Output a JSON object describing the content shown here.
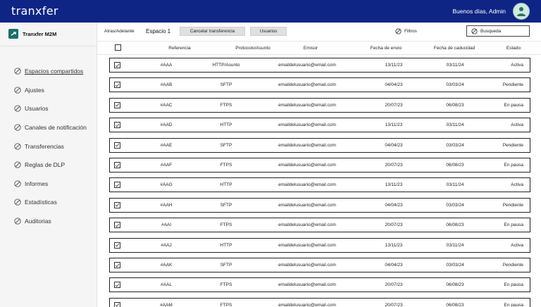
{
  "app": {
    "logo": "tranxfer",
    "greeting": "Buenos días, Admin"
  },
  "brand": {
    "name": "Tranxfer M2M"
  },
  "toolbar": {
    "back_forward": "Atras/Adelante",
    "space_title": "Espacio 1",
    "cancel_label": "Cancelar transferencia",
    "users_label": "Usuarios",
    "filters_label": "Filtros",
    "search_placeholder": "Busqueda"
  },
  "sidebar": {
    "items": [
      {
        "label": "Espacios compartidos",
        "active": true
      },
      {
        "label": "Ajustes"
      },
      {
        "label": "Usuarios"
      },
      {
        "label": "Canales de notificación"
      },
      {
        "label": "Transferencias"
      },
      {
        "label": "Reglas de DLP"
      },
      {
        "label": "Informes"
      },
      {
        "label": "Estadísticas"
      },
      {
        "label": "Auditorias"
      }
    ]
  },
  "table": {
    "columns": {
      "referencia": "Referencia",
      "protocolo": "Protocolo/Asunto",
      "emisor": "Emisor",
      "envio": "Fecha de envio",
      "caducidad": "Fecha de caducidad",
      "estado": "Estado"
    },
    "rows": [
      {
        "ref": "#AAA",
        "proto": "HTTP/Asunto",
        "emisor": "emaildelusuario@email.com",
        "envio": "13/11/23",
        "cad": "03/11/24",
        "estado": "Activa"
      },
      {
        "ref": "#AAB",
        "proto": "SFTP",
        "emisor": "emaildelusuario@email.com",
        "envio": "04/04/23",
        "cad": "03/03/24",
        "estado": "Pendiente"
      },
      {
        "ref": "#AAC",
        "proto": "FTPS",
        "emisor": "emaildelusuario@email.com",
        "envio": "20/07/23",
        "cad": "06/08/23",
        "estado": "En pausa"
      },
      {
        "ref": "#AAD",
        "proto": "HTTP",
        "emisor": "emaildelusuario@email.com",
        "envio": "13/11/23",
        "cad": "03/11/24",
        "estado": "Activa"
      },
      {
        "ref": "#AAE",
        "proto": "SFTP",
        "emisor": "emaildelusuario@email.com",
        "envio": "04/04/23",
        "cad": "03/03/24",
        "estado": "Pendiente"
      },
      {
        "ref": "#AAF",
        "proto": "FTPS",
        "emisor": "emaildelusuario@email.com",
        "envio": "20/07/23",
        "cad": "06/08/23",
        "estado": "En pausa"
      },
      {
        "ref": "#AAG",
        "proto": "HTTP",
        "emisor": "emaildelusuario@email.com",
        "envio": "13/11/23",
        "cad": "03/11/24",
        "estado": "Activa"
      },
      {
        "ref": "#AAH",
        "proto": "SFTP",
        "emisor": "emaildelusuario@email.com",
        "envio": "04/04/23",
        "cad": "03/03/24",
        "estado": "Pendiente"
      },
      {
        "ref": "#AAI",
        "proto": "FTPS",
        "emisor": "emaildelusuario@email.com",
        "envio": "20/07/23",
        "cad": "06/08/23",
        "estado": "En pausa"
      },
      {
        "ref": "#AAJ",
        "proto": "HTTP",
        "emisor": "emaildelusuario@email.com",
        "envio": "13/11/23",
        "cad": "03/11/24",
        "estado": "Activa"
      },
      {
        "ref": "#AAK",
        "proto": "SFTP",
        "emisor": "emaildelusuario@email.com",
        "envio": "04/04/23",
        "cad": "03/03/24",
        "estado": "Pendiente"
      },
      {
        "ref": "#AAL",
        "proto": "FTPS",
        "emisor": "emaildelusuario@email.com",
        "envio": "20/07/23",
        "cad": "06/08/23",
        "estado": "En pausa"
      },
      {
        "ref": "#AAM",
        "proto": "FTPS",
        "emisor": "emaildelusuario@email.com",
        "envio": "20/07/23",
        "cad": "06/08/23",
        "estado": "En pausa"
      }
    ]
  },
  "colors": {
    "topbar": "#0f2585",
    "sidebar": "#f5f5f5",
    "brand_icon": "#1b6f6a"
  }
}
